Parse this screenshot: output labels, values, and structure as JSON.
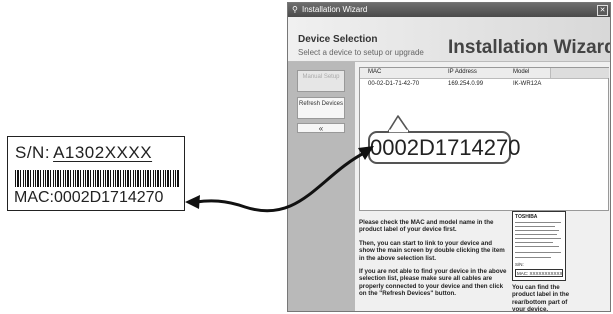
{
  "label": {
    "sn_prefix": "S/N:",
    "sn_value": "A1302XXXX",
    "mac": "MAC:0002D1714270"
  },
  "window": {
    "title": "Installation Wizard",
    "close": "✕",
    "section_title": "Device Selection",
    "section_subtitle": "Select a device to setup or upgrade",
    "big_title": "Installation Wizard"
  },
  "sidebar": {
    "manual_setup": "Manual Setup",
    "refresh_devices": "Refresh Devices",
    "expand": "«"
  },
  "table": {
    "headers": [
      "MAC",
      "IP Address",
      "Model"
    ],
    "rows": [
      [
        "00-02-D1-71-42-70",
        "169.254.0.99",
        "IK-WR12A"
      ]
    ]
  },
  "callout": "0002D1714270",
  "instructions": {
    "p1": "Please check the MAC and model name in the product label of your device first.",
    "p2": "Then, you can start to link to your device and show the main screen by double clicking the item in the above selection list.",
    "p3": "If you are not able to find your device in the above selection list, please make sure all cables are properly connected to your device and then click on the \"Refresh Devices\" button.",
    "side": "You can find the product label in the rear/bottom part of your device."
  },
  "mini_label": {
    "brand": "TOSHIBA",
    "sn": "S/N:",
    "mac": "MAC: XXXXXXXXXXXX"
  }
}
